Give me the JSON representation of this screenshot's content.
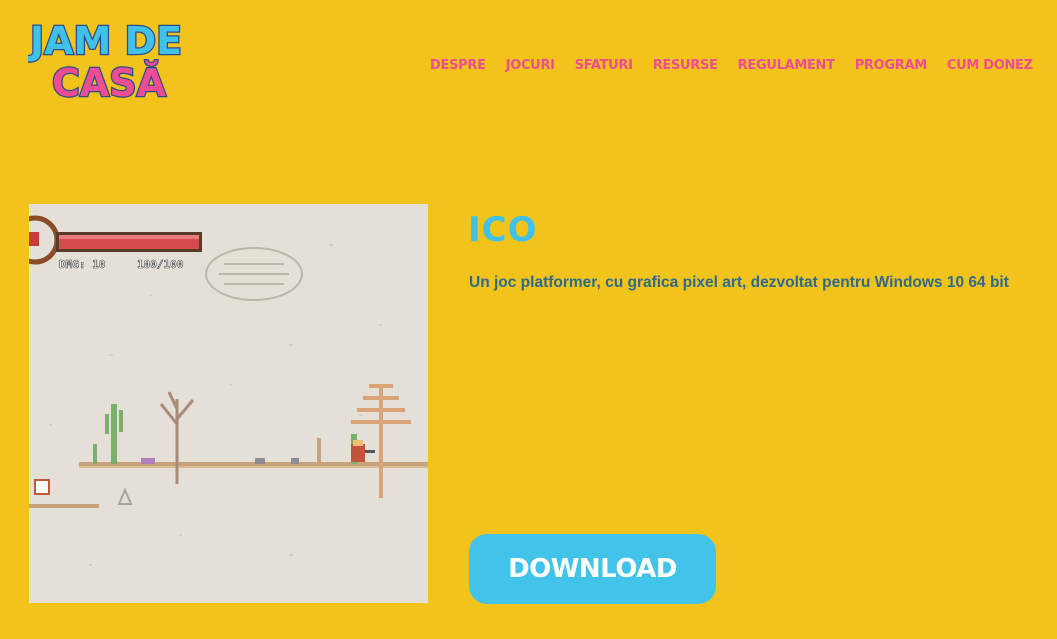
{
  "logo": {
    "line1": "JAM DE",
    "line2": "CASĂ"
  },
  "nav": {
    "items": [
      {
        "label": "DESPRE"
      },
      {
        "label": "JOCURI"
      },
      {
        "label": "SFATURI"
      },
      {
        "label": "RESURSE"
      },
      {
        "label": "REGULAMENT"
      },
      {
        "label": "PROGRAM"
      },
      {
        "label": "CUM DONEZ"
      }
    ]
  },
  "game": {
    "title": "ICO",
    "description": "Un joc platformer, cu grafica pixel art, dezvoltat pentru Windows 10 64 bit",
    "download_label": "DOWNLOAD",
    "hud": {
      "dmg_text": "DMG: 10",
      "hp_text": "100/100"
    }
  },
  "colors": {
    "background": "#f2c31b",
    "nav_pink": "#ee4d93",
    "title_blue": "#3fc1e8",
    "desc_blue": "#2d6a8e",
    "button_blue": "#41c3ea"
  }
}
